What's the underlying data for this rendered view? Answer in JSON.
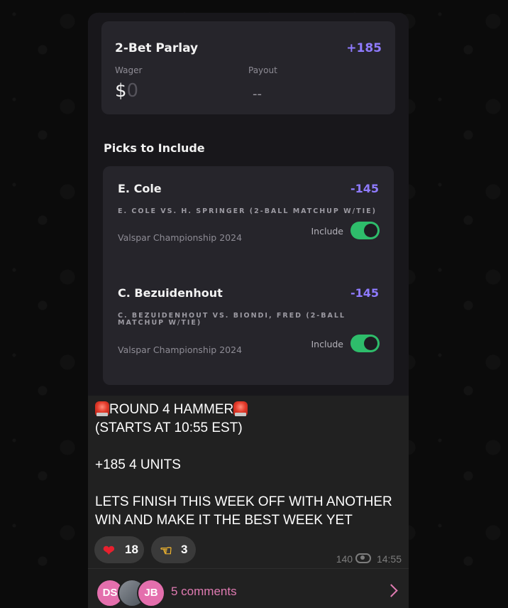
{
  "parlay": {
    "title": "2-Bet Parlay",
    "odds": "+185",
    "wager_label": "Wager",
    "wager_currency": "$",
    "wager_value": "0",
    "payout_label": "Payout",
    "payout_value": "--"
  },
  "picks_heading": "Picks to Include",
  "picks": [
    {
      "name": "E. Cole",
      "odds": "-145",
      "matchup": "E. COLE VS. H. SPRINGER (2-BALL MATCHUP W/TIE)",
      "event": "Valspar Championship 2024",
      "include_label": "Include",
      "included": true
    },
    {
      "name": "C. Bezuidenhout",
      "odds": "-145",
      "matchup": "C. BEZUIDENHOUT VS. BIONDI, FRED (2-BALL MATCHUP W/TIE)",
      "event": "Valspar Championship 2024",
      "include_label": "Include",
      "included": true
    }
  ],
  "caption": {
    "line1": "ROUND 4 HAMMER",
    "line2": "(STARTS AT 10:55 EST)",
    "line3": "+185 4 UNITS",
    "line4": "LETS FINISH THIS WEEK OFF WITH ANOTHER WIN AND MAKE IT THE BEST WEEK YET"
  },
  "reactions": [
    {
      "emoji": "heart-icon",
      "count": "18"
    },
    {
      "emoji": "pointing-hand-icon",
      "count": "3"
    }
  ],
  "meta": {
    "views": "140",
    "time": "14:55"
  },
  "comments": {
    "avatars": [
      "DS",
      "",
      "JB"
    ],
    "label": "5 comments"
  },
  "colors": {
    "accent_purple": "#8f7bff",
    "toggle_green": "#2ebd6b",
    "comments_pink": "#e07bb2"
  }
}
